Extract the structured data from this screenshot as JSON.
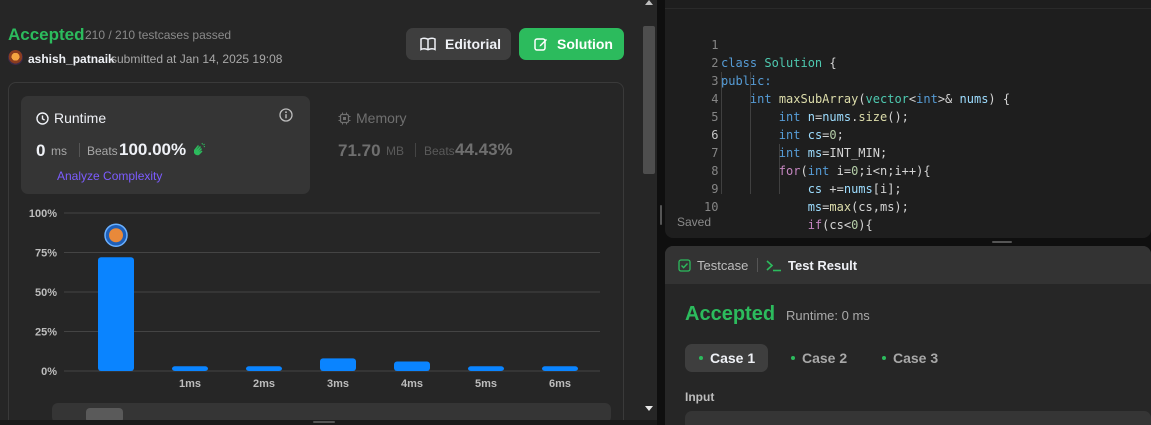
{
  "submission": {
    "status": "Accepted",
    "tests_passed": "210 / 210 testcases passed",
    "username": "ashish_patnaik",
    "submitted_at": "submitted at Jan 14, 2025 19:08",
    "editorial_label": "Editorial",
    "solution_label": "Solution"
  },
  "runtime": {
    "title": "Runtime",
    "value": "0",
    "unit": "ms",
    "beats_label": "Beats",
    "beats_pct": "100.00%",
    "analyze_label": "Analyze Complexity"
  },
  "memory": {
    "title": "Memory",
    "value": "71.70",
    "unit": "MB",
    "beats_label": "Beats",
    "beats_pct": "44.43%"
  },
  "chart_data": {
    "type": "bar",
    "categories": [
      "",
      "1ms",
      "2ms",
      "3ms",
      "4ms",
      "5ms",
      "6ms"
    ],
    "values": [
      72,
      3,
      3,
      8,
      6,
      3,
      3
    ],
    "ylim": [
      0,
      100
    ],
    "yticks": [
      "0%",
      "25%",
      "50%",
      "75%",
      "100%"
    ],
    "grid": true,
    "highlight_index": 0,
    "bar_color": "#0a84ff",
    "grid_color": "#444444"
  },
  "editor": {
    "lines": [
      {
        "n": "1"
      },
      {
        "n": "2"
      },
      {
        "n": "3"
      },
      {
        "n": "4"
      },
      {
        "n": "5"
      },
      {
        "n": "6"
      },
      {
        "n": "7"
      },
      {
        "n": "8"
      },
      {
        "n": "9"
      },
      {
        "n": "10"
      }
    ],
    "code": {
      "l1a": "class",
      "l1b": "Solution",
      "l1c": "{",
      "l2": "public:",
      "l3a": "int",
      "l3b": "maxSubArray",
      "l3c": "(",
      "l3d": "vector",
      "l3e": "<",
      "l3f": "int",
      "l3g": ">& ",
      "l3h": "nums",
      "l3i": ") {",
      "l4a": "int",
      "l4b": "n",
      "l4c": "=",
      "l4d": "nums",
      "l4e": ".",
      "l4f": "size",
      "l4g": "();",
      "l5a": "int",
      "l5b": "cs",
      "l5c": "=",
      "l5d": "0",
      "l5e": ";",
      "l6a": "int",
      "l6b": "ms",
      "l6c": "=INT_MIN;",
      "l7a": "for",
      "l7b": "(",
      "l7c": "int",
      "l7d": " i=",
      "l7e": "0",
      "l7f": ";i<n;i++){",
      "l8a": "cs",
      "l8b": " +=",
      "l8c": "nums",
      "l8d": "[i];",
      "l9a": "ms",
      "l9b": "=",
      "l9c": "max",
      "l9d": "(cs,ms);",
      "l10a": "if",
      "l10b": "(cs<",
      "l10c": "0",
      "l10d": "){"
    },
    "saved_label": "Saved"
  },
  "result": {
    "tab_testcase": "Testcase",
    "tab_result": "Test Result",
    "status": "Accepted",
    "runtime": "Runtime: 0 ms",
    "cases": [
      "Case 1",
      "Case 2",
      "Case 3"
    ],
    "input_label": "Input"
  },
  "colors": {
    "accent_green": "#2cbb5d",
    "link_purple": "#7c5cff",
    "bar_blue": "#0a84ff"
  }
}
